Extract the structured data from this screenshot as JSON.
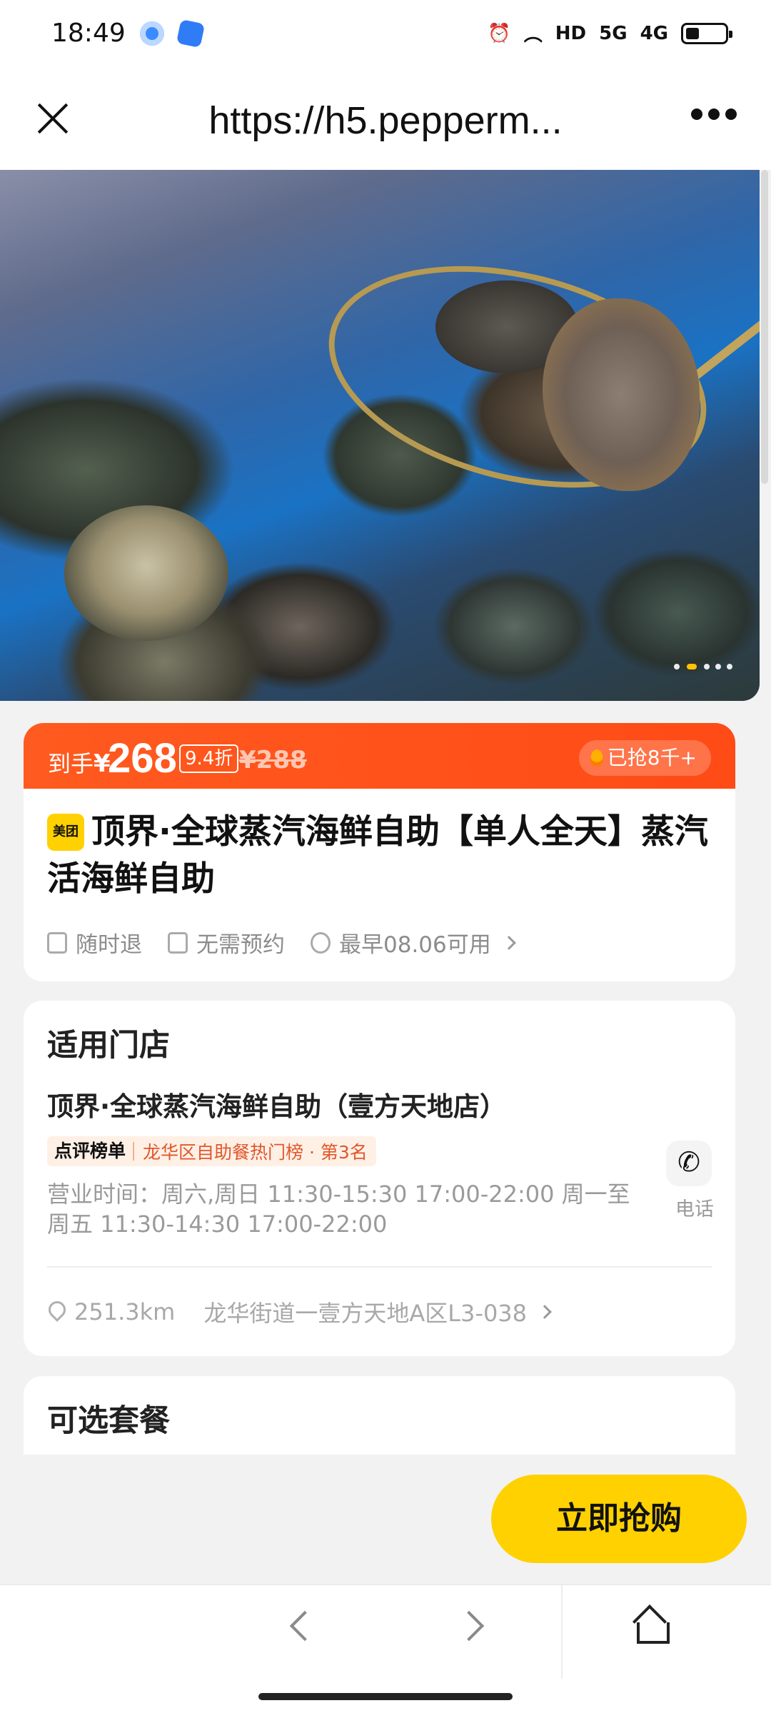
{
  "status_bar": {
    "time": "18:49",
    "app_icons": [
      "browser-icon",
      "notes-icon"
    ],
    "indicators": [
      "alarm-icon",
      "wifi-icon",
      "HD",
      "5G",
      "4G"
    ]
  },
  "browser": {
    "url_title": "https://h5.pepperm...",
    "close_icon": "close-icon",
    "more_icon": "more-icon"
  },
  "hero": {
    "image_subject": "seafood-photo",
    "carousel": {
      "total": 5,
      "active": 2
    }
  },
  "price": {
    "prefix": "到手",
    "currency": "¥",
    "value": "268",
    "discount": "9.4折",
    "original": "¥288",
    "sold": "已抢8千+"
  },
  "deal": {
    "brand_badge": "美团",
    "title": "顶界·全球蒸汽海鲜自助【单人全天】蒸汽活海鲜自助",
    "tags": [
      {
        "icon": "refund-icon",
        "label": "随时退"
      },
      {
        "icon": "calendar-check-icon",
        "label": "无需预约"
      },
      {
        "icon": "check-circle-icon",
        "label": "最早08.06可用"
      }
    ]
  },
  "store": {
    "section_title": "适用门店",
    "name": "顶界·全球蒸汽海鲜自助（壹方天地店）",
    "rank_brand": "点评榜单",
    "rank_text": "龙华区自助餐热门榜 · 第3名",
    "hours": "营业时间：周六,周日 11:30-15:30 17:00-22:00 周一至周五 11:30-14:30 17:00-22:00",
    "phone_label": "电话",
    "distance": "251.3km",
    "address": "龙华街道一壹方天地A区L3-038"
  },
  "packages": {
    "section_title": "可选套餐"
  },
  "actions": {
    "buy_label": "立即抢购"
  },
  "colors": {
    "price_banner": "#ff4b16",
    "buy_button": "#ffd100",
    "rank_text": "#e0572a"
  }
}
